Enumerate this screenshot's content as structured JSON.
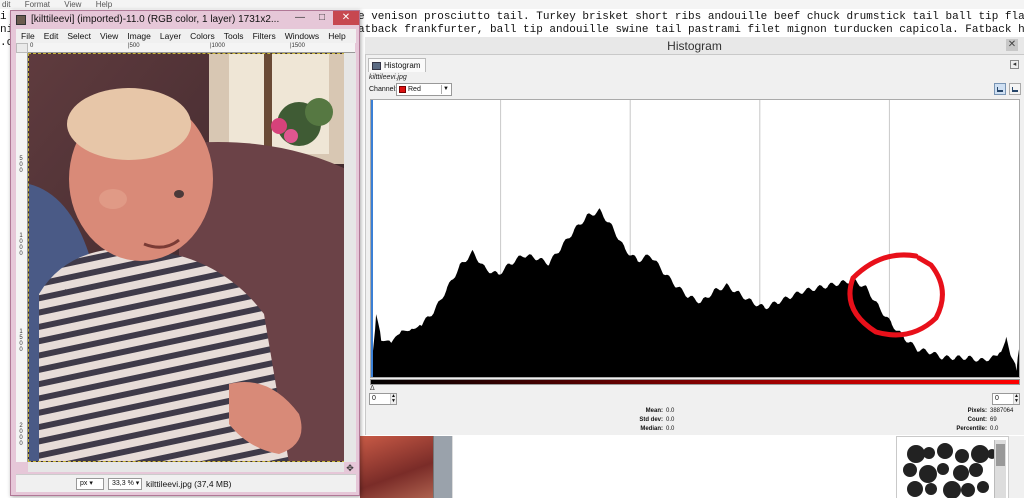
{
  "editor": {
    "menu": [
      "dit",
      "Format",
      "View",
      "Help"
    ],
    "line1": "e venison prosciutto tail. Turkey brisket short ribs andouille beef chuck drumstick tail ball tip flank",
    "line2": "atback frankfurter, ball tip andouille swine tail pastrami filet mignon turducken capicola. Fatback ham",
    "left_fragment": "i\nni\n.oa"
  },
  "gimp": {
    "title": "[kilttileevi] (imported)-11.0 (RGB color, 1 layer) 1731x2...",
    "window_buttons": {
      "minimize": "—",
      "maximize": "□",
      "close": "✕"
    },
    "menu": [
      "File",
      "Edit",
      "Select",
      "View",
      "Image",
      "Layer",
      "Colors",
      "Tools",
      "Filters",
      "Windows",
      "Help"
    ],
    "ruler_top": [
      "0",
      "|500",
      "|1000",
      "|1500"
    ],
    "ruler_left": [
      "5\n0\n0",
      "1\n0\n0\n0",
      "1\n5\n0\n0",
      "2\n0\n0\n0"
    ],
    "status": {
      "unit": "px",
      "zoom": "33,3 %",
      "text": "kilttileevi.jpg (37,4 MB)"
    },
    "nav_icon": "✥"
  },
  "histogram": {
    "dock_title": "Histogram",
    "close_glyph": "✕",
    "tab_label": "Histogram",
    "tab_menu_glyph": "◂",
    "image_name": "kilttileevi.jpg",
    "channel_label": "Channel:",
    "channel_value": "Red",
    "channel_color": "#dd1111",
    "range_min": "0",
    "range_max": "0",
    "marker": "Δ",
    "stats": {
      "mean_label": "Mean:",
      "mean_value": "0.0",
      "stddev_label": "Std dev:",
      "stddev_value": "0.0",
      "median_label": "Median:",
      "median_value": "0.0",
      "pixels_label": "Pixels:",
      "pixels_value": "3887064",
      "count_label": "Count:",
      "count_value": "69",
      "percentile_label": "Percentile:",
      "percentile_value": "0.0"
    },
    "annotation_color": "#e8101a"
  },
  "chart_data": {
    "type": "area",
    "title": "",
    "xlabel": "",
    "ylabel": "",
    "xlim": [
      0,
      255
    ],
    "ylim": [
      0,
      100
    ],
    "grid": "vertical",
    "x": [
      0,
      2,
      4,
      8,
      12,
      16,
      20,
      25,
      30,
      35,
      40,
      45,
      50,
      55,
      60,
      65,
      70,
      75,
      80,
      85,
      90,
      95,
      100,
      105,
      110,
      115,
      120,
      125,
      130,
      135,
      140,
      145,
      150,
      155,
      160,
      165,
      170,
      175,
      180,
      185,
      190,
      195,
      200,
      205,
      210,
      215,
      220,
      225,
      230,
      235,
      240,
      245,
      248,
      250,
      252,
      254,
      255
    ],
    "values": [
      2,
      22,
      14,
      12,
      16,
      18,
      19,
      24,
      32,
      40,
      45,
      39,
      37,
      41,
      44,
      43,
      41,
      47,
      53,
      58,
      60,
      54,
      46,
      42,
      44,
      38,
      33,
      29,
      27,
      31,
      33,
      30,
      27,
      25,
      27,
      29,
      31,
      32,
      33,
      34,
      35,
      32,
      25,
      19,
      14,
      10,
      9,
      7,
      7,
      7,
      6,
      7,
      10,
      14,
      7,
      3,
      10
    ],
    "series": [
      {
        "values_ref": "values"
      }
    ]
  }
}
